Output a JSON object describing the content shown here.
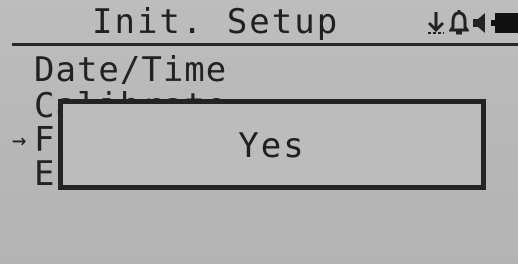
{
  "header": {
    "title": "Init. Setup",
    "icons": [
      "pin-icon",
      "bell-icon",
      "speaker-icon",
      "battery-icon"
    ]
  },
  "menu": {
    "items": [
      {
        "label": "Date/Time"
      },
      {
        "label": "Calibrate"
      },
      {
        "label": "F"
      },
      {
        "label": "E"
      }
    ],
    "selected_index": 2,
    "cursor": "→"
  },
  "dialog": {
    "text": "Yes"
  },
  "colors": {
    "lcd_background": "#bcbcbc",
    "lcd_foreground": "#202020"
  }
}
